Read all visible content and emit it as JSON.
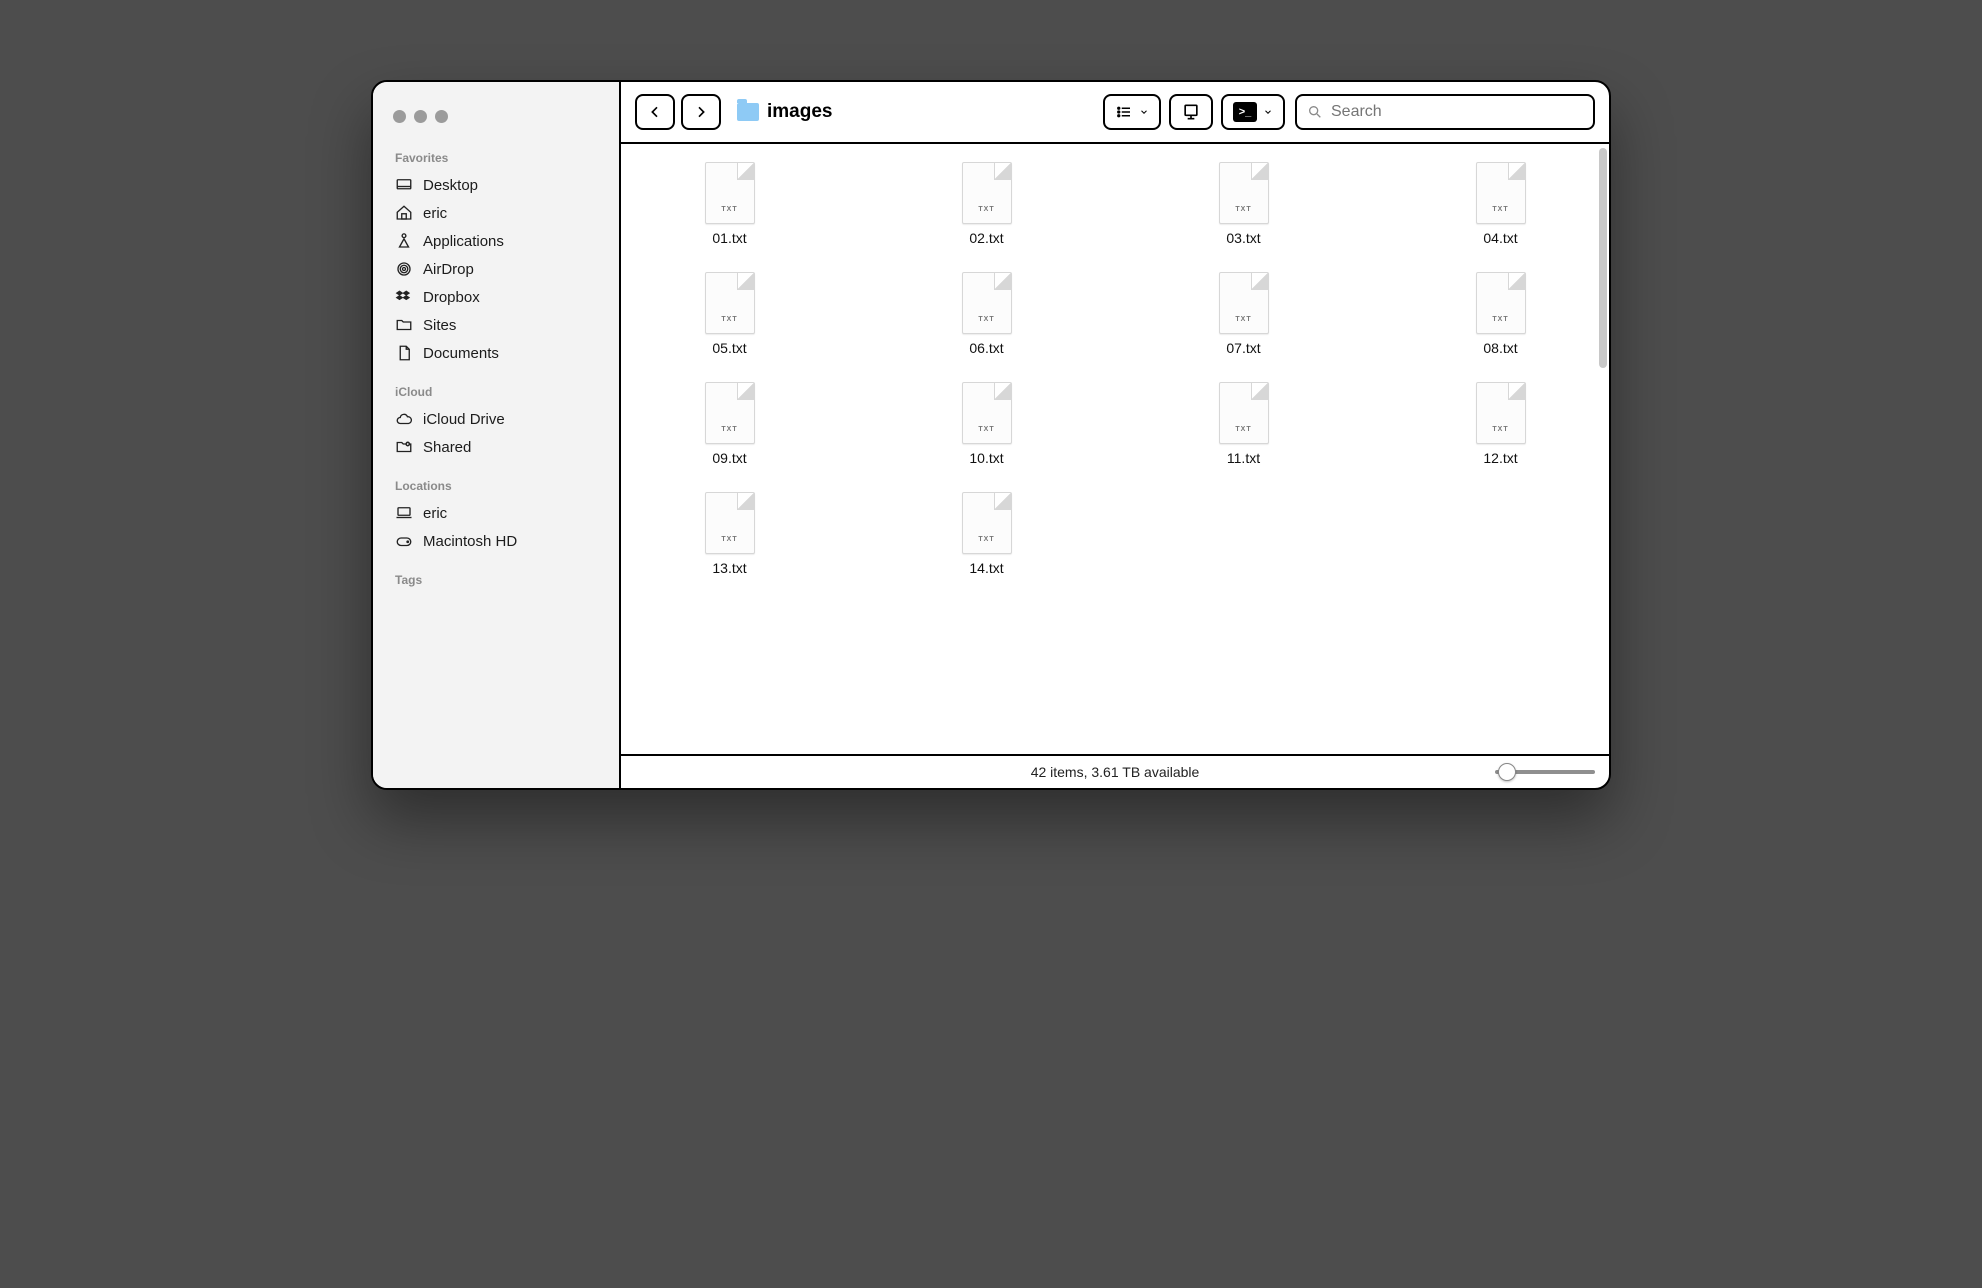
{
  "window": {
    "title": "images",
    "search_placeholder": "Search"
  },
  "sidebar": {
    "sections": [
      {
        "label": "Favorites",
        "items": [
          {
            "icon": "desktop",
            "label": "Desktop"
          },
          {
            "icon": "home",
            "label": "eric"
          },
          {
            "icon": "apps",
            "label": "Applications"
          },
          {
            "icon": "airdrop",
            "label": "AirDrop"
          },
          {
            "icon": "dropbox",
            "label": "Dropbox"
          },
          {
            "icon": "folder",
            "label": "Sites"
          },
          {
            "icon": "document",
            "label": "Documents"
          }
        ]
      },
      {
        "label": "iCloud",
        "items": [
          {
            "icon": "cloud",
            "label": "iCloud Drive"
          },
          {
            "icon": "shared",
            "label": "Shared"
          }
        ]
      },
      {
        "label": "Locations",
        "items": [
          {
            "icon": "laptop",
            "label": "eric"
          },
          {
            "icon": "disk",
            "label": "Macintosh HD"
          }
        ]
      },
      {
        "label": "Tags",
        "items": []
      }
    ]
  },
  "files": [
    {
      "name": "01.txt",
      "type": "TXT"
    },
    {
      "name": "02.txt",
      "type": "TXT"
    },
    {
      "name": "03.txt",
      "type": "TXT"
    },
    {
      "name": "04.txt",
      "type": "TXT"
    },
    {
      "name": "05.txt",
      "type": "TXT"
    },
    {
      "name": "06.txt",
      "type": "TXT"
    },
    {
      "name": "07.txt",
      "type": "TXT"
    },
    {
      "name": "08.txt",
      "type": "TXT"
    },
    {
      "name": "09.txt",
      "type": "TXT"
    },
    {
      "name": "10.txt",
      "type": "TXT"
    },
    {
      "name": "11.txt",
      "type": "TXT"
    },
    {
      "name": "12.txt",
      "type": "TXT"
    },
    {
      "name": "13.txt",
      "type": "TXT"
    },
    {
      "name": "14.txt",
      "type": "TXT"
    }
  ],
  "status": {
    "text": "42 items, 3.61 TB available"
  }
}
